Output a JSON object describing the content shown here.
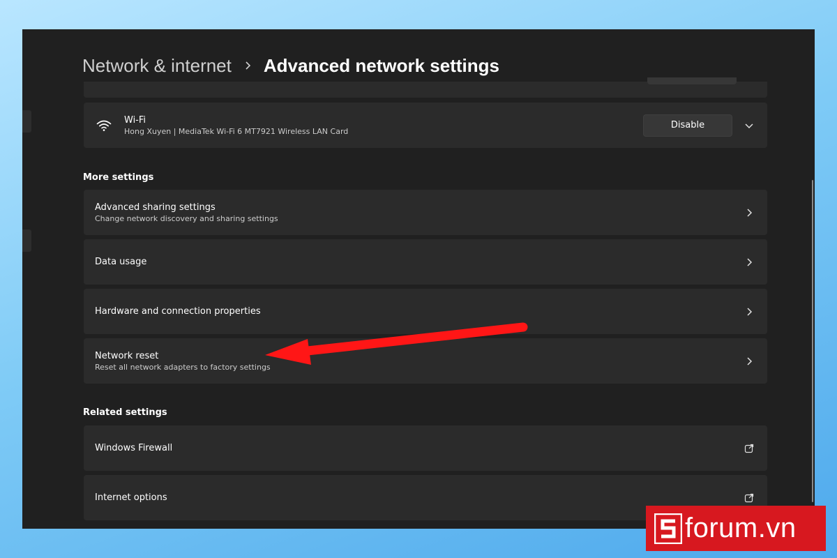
{
  "breadcrumb": {
    "parent": "Network & internet",
    "current": "Advanced network settings"
  },
  "adapters": {
    "wifi": {
      "title": "Wi-Fi",
      "subtitle": "Hong Xuyen | MediaTek Wi-Fi 6 MT7921 Wireless LAN Card",
      "button_label": "Disable",
      "icon": "wifi-icon"
    }
  },
  "more_settings": {
    "label": "More settings",
    "items": [
      {
        "title": "Advanced sharing settings",
        "subtitle": "Change network discovery and sharing settings"
      },
      {
        "title": "Data usage",
        "subtitle": ""
      },
      {
        "title": "Hardware and connection properties",
        "subtitle": ""
      },
      {
        "title": "Network reset",
        "subtitle": "Reset all network adapters to factory settings"
      }
    ]
  },
  "related_settings": {
    "label": "Related settings",
    "items": [
      {
        "title": "Windows Firewall"
      },
      {
        "title": "Internet options"
      }
    ]
  },
  "brand": {
    "text": "forum.vn",
    "color": "#d7181f"
  },
  "colors": {
    "window_bg": "#202020",
    "card_bg": "#2b2b2b",
    "annotation_arrow": "#ff1616"
  }
}
